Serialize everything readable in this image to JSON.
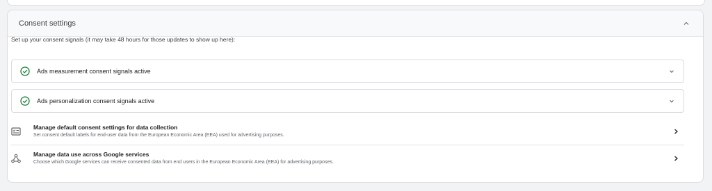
{
  "card": {
    "title": "Consent settings",
    "intro": "Set up your consent signals (it may take 48 hours for those updates to show up here):"
  },
  "signals": [
    {
      "label": "Ads measurement consent signals active",
      "icon": "check-circle-icon",
      "color": "#188038"
    },
    {
      "label": "Ads personalization consent signals active",
      "icon": "check-circle-icon",
      "color": "#188038"
    }
  ],
  "rows": [
    {
      "title": "Manage default consent settings for data collection",
      "description": "Set consent default labels for end-user data from the European Economic Area (EEA) used for advertising purposes.",
      "icon": "consent-settings-icon"
    },
    {
      "title": "Manage data use across Google services",
      "description": "Choose which Google services can receive consented data from end users in the European Economic Area (EEA) for advertising purposes.",
      "icon": "data-sharing-icon"
    }
  ]
}
